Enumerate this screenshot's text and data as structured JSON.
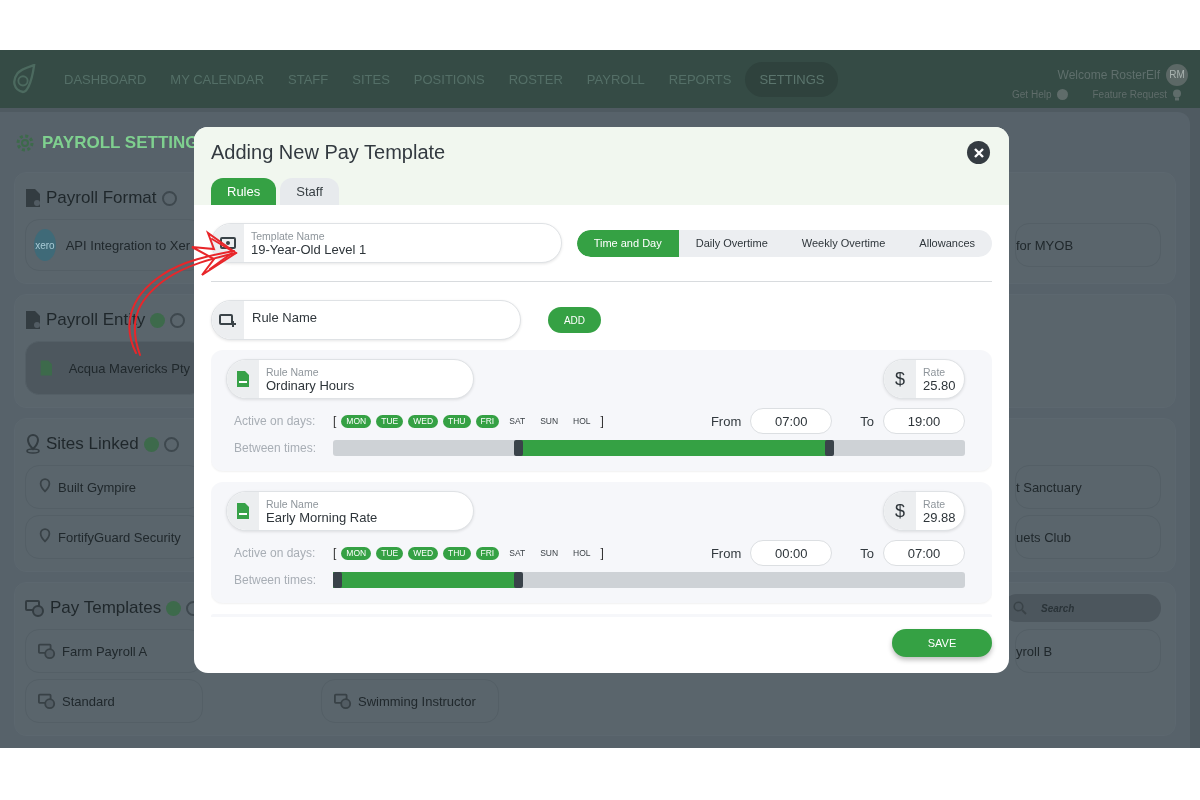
{
  "nav": {
    "items": [
      {
        "label": "DASHBOARD",
        "selected": false
      },
      {
        "label": "MY CALENDAR",
        "selected": false
      },
      {
        "label": "STAFF",
        "selected": false
      },
      {
        "label": "SITES",
        "selected": false
      },
      {
        "label": "POSITIONS",
        "selected": false
      },
      {
        "label": "ROSTER",
        "selected": false
      },
      {
        "label": "PAYROLL",
        "selected": false
      },
      {
        "label": "REPORTS",
        "selected": false
      },
      {
        "label": "SETTINGS",
        "selected": true
      }
    ],
    "welcome": "Welcome RosterElf",
    "avatar": "RM",
    "help": "Get Help",
    "feature": "Feature Request"
  },
  "page": {
    "title": "PAYROLL SETTING",
    "sections": [
      {
        "kind": "format",
        "title": "Payroll Format",
        "add": false,
        "rows": [
          {
            "left": "API Integration to Xer",
            "logo": "xero",
            "right": "for MYOB"
          }
        ]
      },
      {
        "kind": "entity",
        "title": "Payroll Entity",
        "add": true,
        "rows": [
          {
            "left": "Acqua Mavericks Pty"
          }
        ]
      },
      {
        "kind": "sites",
        "title": "Sites Linked",
        "add": true,
        "rows": [
          {
            "left": "Built Gympire",
            "right": "t Sanctuary"
          },
          {
            "left": "FortifyGuard Security",
            "right": "uets Club"
          }
        ]
      },
      {
        "kind": "templates",
        "title": "Pay Templates",
        "add": true,
        "search": "Search",
        "rows": [
          {
            "left": "Farm Payroll A",
            "right": "yroll B"
          },
          {
            "left": "Standard",
            "middle": "Swimming Instructor"
          }
        ]
      }
    ]
  },
  "modal": {
    "title": "Adding New Pay Template",
    "tabs": [
      {
        "label": "Rules",
        "selected": true
      },
      {
        "label": "Staff",
        "selected": false
      }
    ],
    "template": {
      "label": "Template Name",
      "value": "19-Year-Old Level 1"
    },
    "modes": [
      {
        "label": "Time and Day",
        "selected": true
      },
      {
        "label": "Daily Overtime",
        "selected": false
      },
      {
        "label": "Weekly Overtime",
        "selected": false
      },
      {
        "label": "Allowances",
        "selected": false
      }
    ],
    "rule_input": {
      "placeholder": "Rule Name"
    },
    "add": "ADD",
    "rules": [
      {
        "name_label": "Rule Name",
        "name": "Ordinary Hours",
        "rate_label": "Rate",
        "currency": "$",
        "rate": "25.80",
        "days_label": "Active on days:",
        "open": "[",
        "close": "]",
        "days": [
          {
            "label": "MON",
            "on": true
          },
          {
            "label": "TUE",
            "on": true
          },
          {
            "label": "WED",
            "on": true
          },
          {
            "label": "THU",
            "on": true
          },
          {
            "label": "FRI",
            "on": true
          },
          {
            "label": "SAT",
            "on": false
          },
          {
            "label": "SUN",
            "on": false
          },
          {
            "label": "HOL",
            "on": false
          }
        ],
        "from_label": "From",
        "from": "07:00",
        "to_label": "To",
        "to": "19:00",
        "between_label": "Between times:",
        "handles": [
          {
            "level": 0.29
          },
          {
            "level": 0.79
          }
        ]
      },
      {
        "name_label": "Rule Name",
        "name": "Early Morning Rate",
        "rate_label": "Rate",
        "currency": "$",
        "rate": "29.88",
        "days_label": "Active on days:",
        "open": "[",
        "close": "]",
        "days": [
          {
            "label": "MON",
            "on": true
          },
          {
            "label": "TUE",
            "on": true
          },
          {
            "label": "WED",
            "on": true
          },
          {
            "label": "THU",
            "on": true
          },
          {
            "label": "FRI",
            "on": true
          },
          {
            "label": "SAT",
            "on": false
          },
          {
            "label": "SUN",
            "on": false
          },
          {
            "label": "HOL",
            "on": false
          }
        ],
        "from_label": "From",
        "from": "00:00",
        "to_label": "To",
        "to": "07:00",
        "between_label": "Between times:",
        "handles": [
          {
            "level": 0
          },
          {
            "level": 0.29
          }
        ]
      }
    ],
    "save": "SAVE"
  }
}
